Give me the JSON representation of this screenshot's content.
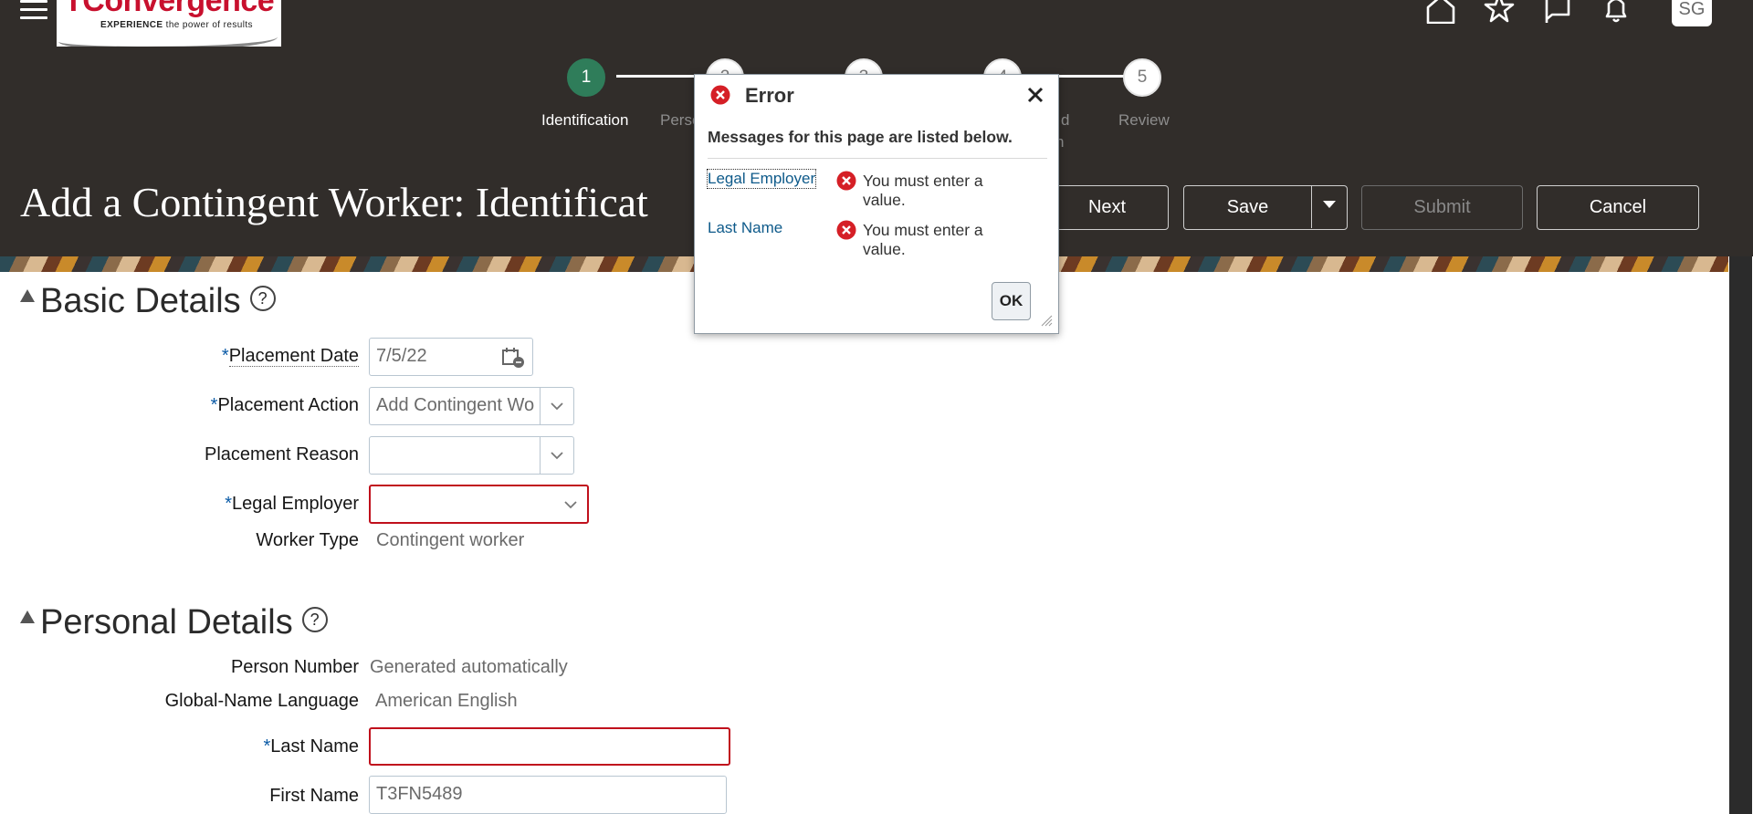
{
  "header": {
    "logo_text": "TConvergence",
    "logo_tagline_bold": "EXPERIENCE",
    "logo_tagline_rest": "the power of results",
    "avatar_initials": "SG"
  },
  "train": {
    "steps": [
      {
        "number": "1",
        "label": "Identification",
        "active": true
      },
      {
        "number": "2",
        "label": "Perso",
        "active": false
      },
      {
        "number": "3",
        "label": "",
        "active": false
      },
      {
        "number": "4",
        "label": "d",
        "label2": "n",
        "active": false
      },
      {
        "number": "5",
        "label": "Review",
        "active": false
      }
    ]
  },
  "page": {
    "title": "Add a Contingent Worker: Identificat"
  },
  "toolbar": {
    "next_label": "Next",
    "save_label": "Save",
    "submit_label": "Submit",
    "cancel_label": "Cancel"
  },
  "basic_details": {
    "title": "Basic Details",
    "help": "?",
    "placement_date_label": "Placement Date",
    "placement_date_value": "7/5/22",
    "placement_action_label": "Placement Action",
    "placement_action_value": "Add Contingent Wo",
    "placement_reason_label": "Placement Reason",
    "placement_reason_value": "",
    "legal_employer_label": "Legal Employer",
    "legal_employer_value": "",
    "worker_type_label": "Worker Type",
    "worker_type_value": "Contingent worker"
  },
  "personal_details": {
    "title": "Personal Details",
    "help": "?",
    "person_number_label": "Person Number",
    "person_number_value": "Generated automatically",
    "global_name_language_label": "Global-Name Language",
    "global_name_language_value": "American English",
    "last_name_label": "Last Name",
    "last_name_value": "",
    "first_name_label": "First Name",
    "first_name_value": "T3FN5489"
  },
  "required_marker": "*",
  "dialog": {
    "title": "Error",
    "message": "Messages for this page are listed below.",
    "errors": [
      {
        "field": "Legal Employer",
        "text": "You must enter a value."
      },
      {
        "field": "Last Name",
        "text": "You must enter a value."
      }
    ],
    "ok_label": "OK"
  },
  "colors": {
    "header_bg": "#312d2a",
    "active_step": "#2f7d5a",
    "error_red": "#c0101c",
    "link_blue": "#0e5a8a",
    "required_blue": "#0a5aa6"
  }
}
